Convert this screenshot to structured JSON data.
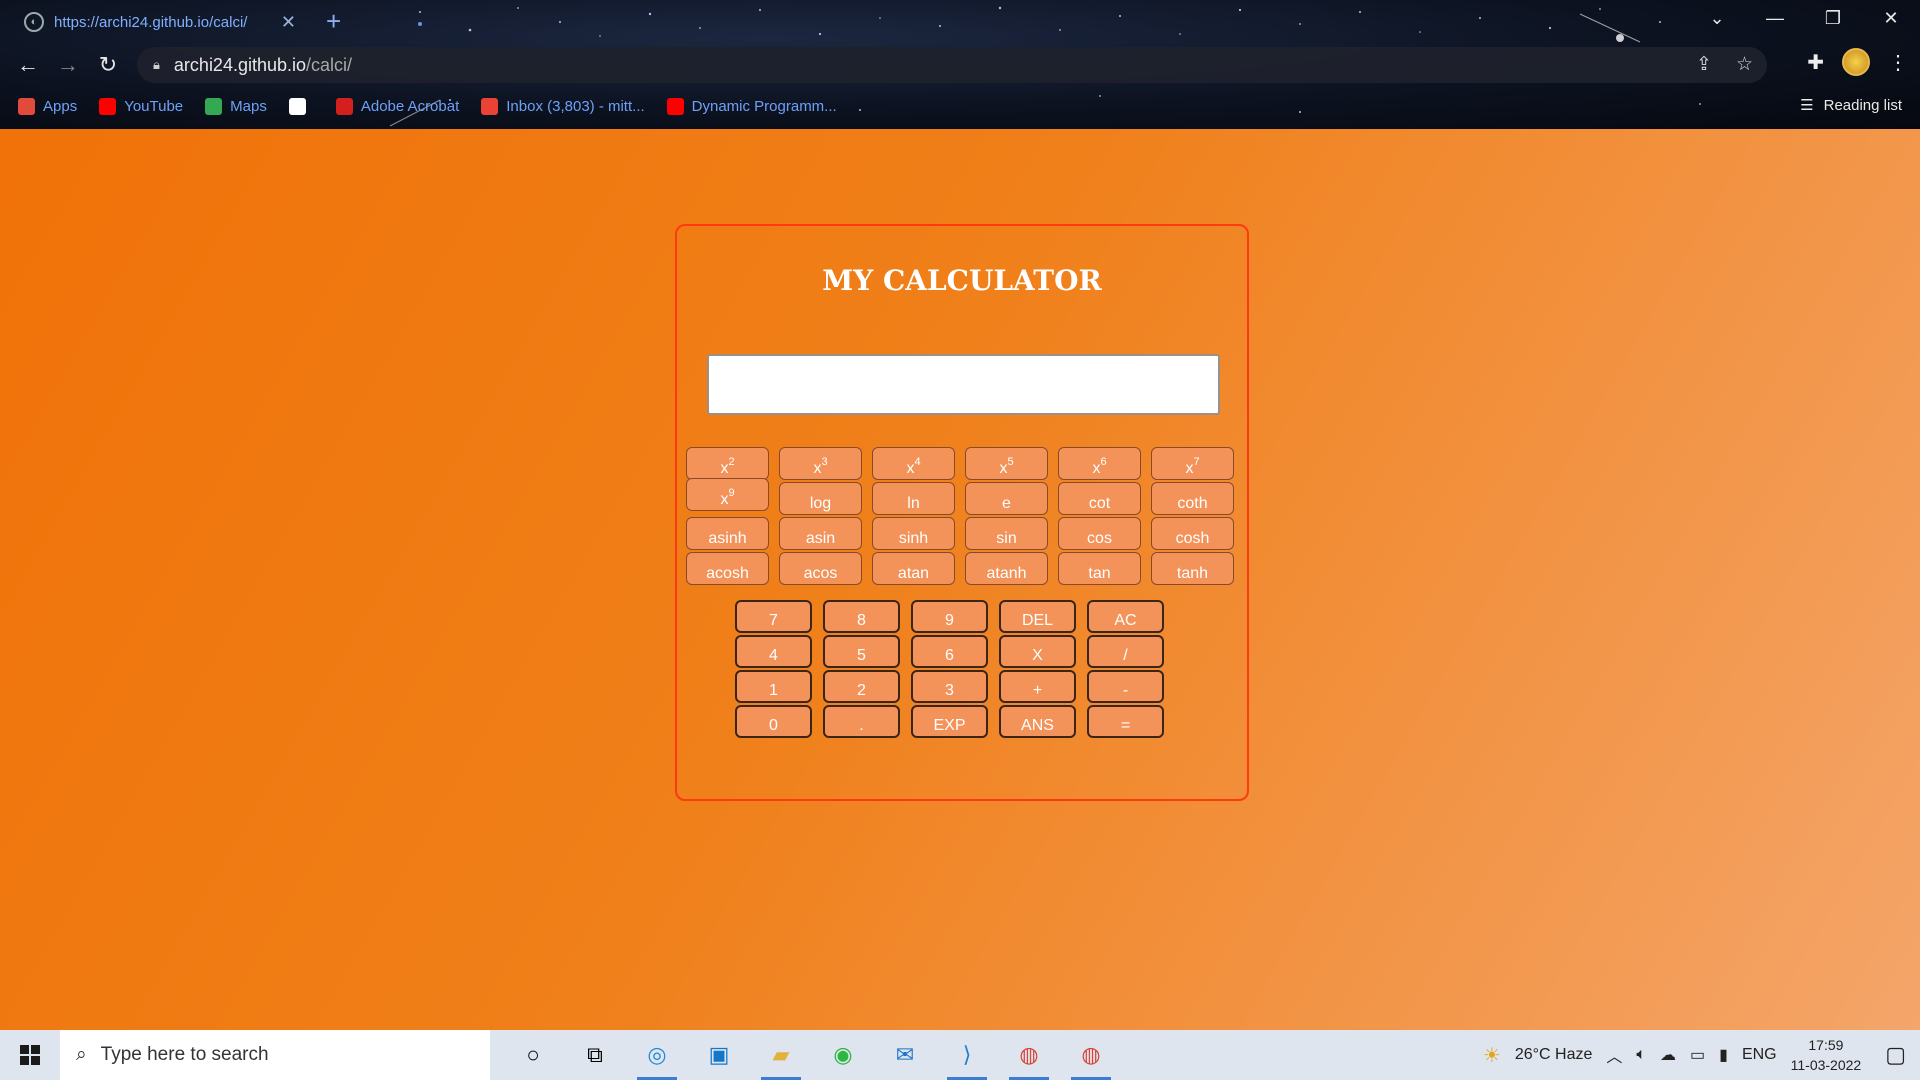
{
  "browser": {
    "tab_title": "https://archi24.github.io/calci/",
    "url_host": "archi24.github.io",
    "url_path": "/calci/",
    "bookmarks": [
      {
        "label": "Apps",
        "icon": "apps-grid-icon",
        "color": "#e24a3b"
      },
      {
        "label": "YouTube",
        "icon": "youtube-icon",
        "color": "#ff0000"
      },
      {
        "label": "Maps",
        "icon": "maps-pin-icon",
        "color": "#34a853"
      },
      {
        "label": "",
        "icon": "globe-icon",
        "color": "#ffffff"
      },
      {
        "label": "Adobe Acrobat",
        "icon": "acrobat-icon",
        "color": "#d3201f"
      },
      {
        "label": "Inbox (3,803) - mitt...",
        "icon": "gmail-icon",
        "color": "#ea4335"
      },
      {
        "label": "Dynamic Programm...",
        "icon": "youtube-icon",
        "color": "#ff0000"
      }
    ],
    "reading_list": "Reading list"
  },
  "calculator": {
    "title": "MY CALCULATOR",
    "display_value": "",
    "scientific_rows": [
      [
        {
          "base": "x",
          "sup": "2"
        },
        {
          "base": "x",
          "sup": "3"
        },
        {
          "base": "x",
          "sup": "4"
        },
        {
          "base": "x",
          "sup": "5"
        },
        {
          "base": "x",
          "sup": "6"
        },
        {
          "base": "x",
          "sup": "7"
        }
      ],
      [
        {
          "base": "x",
          "sup": "9"
        },
        {
          "base": "log",
          "sup": ""
        },
        {
          "base": "ln",
          "sup": ""
        },
        {
          "base": "e",
          "sup": ""
        },
        {
          "base": "cot",
          "sup": ""
        },
        {
          "base": "coth",
          "sup": ""
        }
      ],
      [
        {
          "base": "asinh",
          "sup": ""
        },
        {
          "base": "asin",
          "sup": ""
        },
        {
          "base": "sinh",
          "sup": ""
        },
        {
          "base": "sin",
          "sup": ""
        },
        {
          "base": "cos",
          "sup": ""
        },
        {
          "base": "cosh",
          "sup": ""
        }
      ],
      [
        {
          "base": "acosh",
          "sup": ""
        },
        {
          "base": "acos",
          "sup": ""
        },
        {
          "base": "atan",
          "sup": ""
        },
        {
          "base": "atanh",
          "sup": ""
        },
        {
          "base": "tan",
          "sup": ""
        },
        {
          "base": "tanh",
          "sup": ""
        }
      ]
    ],
    "number_rows": [
      [
        "7",
        "8",
        "9",
        "DEL",
        "AC"
      ],
      [
        "4",
        "5",
        "6",
        "X",
        "/"
      ],
      [
        "1",
        "2",
        "3",
        "+",
        "-"
      ],
      [
        "0",
        ".",
        "EXP",
        "ANS",
        "="
      ]
    ]
  },
  "taskbar": {
    "search_placeholder": "Type here to search",
    "weather": "26°C  Haze",
    "language": "ENG",
    "time": "17:59",
    "date": "11-03-2022"
  }
}
